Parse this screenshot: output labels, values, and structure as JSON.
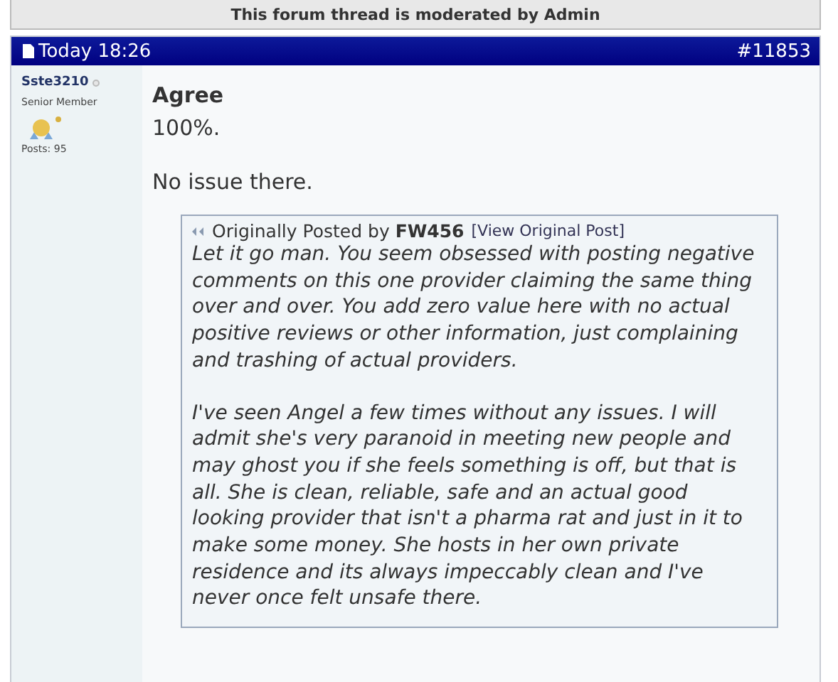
{
  "notice": "This forum thread is moderated by Admin",
  "post": {
    "time": "Today 18:26",
    "number": "#11853",
    "author": {
      "name": "Sste3210",
      "online": false,
      "rank": "Senior Member",
      "posts": "Posts: 95"
    },
    "title": "Agree",
    "paragraphs": [
      "100%.",
      "No issue there."
    ],
    "quote": {
      "prefix": "Originally Posted by",
      "author": "FW456",
      "link": "[View Original Post]",
      "paragraphs": [
        "Let it go man. You seem obsessed with posting negative comments on this one provider claiming the same thing over and over. You add zero value here with no actual positive reviews or other information, just complaining and trashing of actual providers.",
        "I've seen Angel a few times without any issues. I will admit she's very paranoid in meeting new people and may ghost you if she feels something is off, but that is all. She is clean, reliable, safe and an actual good looking provider that isn't a pharma rat and just in it to make some money. She hosts in her own private residence and its always impeccably clean and I've never once felt unsafe there."
      ]
    }
  }
}
